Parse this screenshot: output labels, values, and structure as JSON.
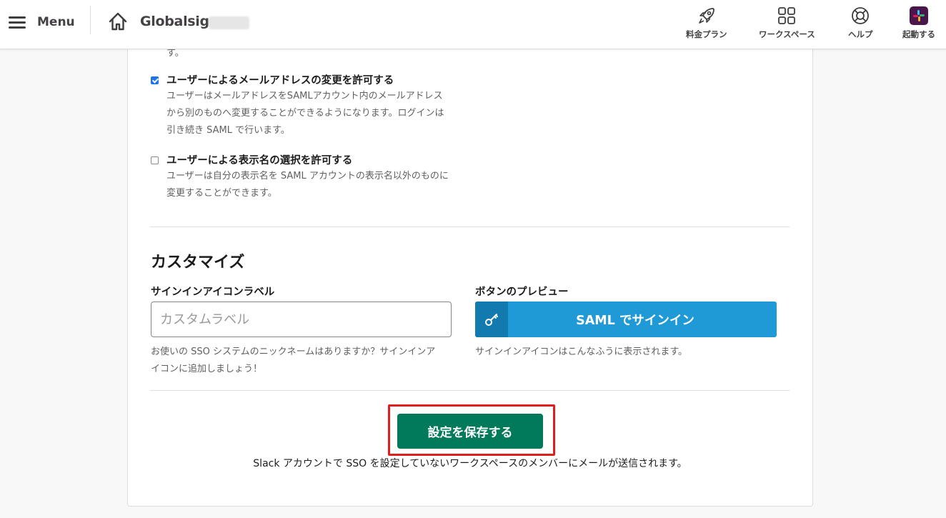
{
  "header": {
    "menu_label": "Menu",
    "workspace_name": "Globalsign",
    "nav": [
      {
        "label": "料金プラン",
        "icon": "rocket-icon"
      },
      {
        "label": "ワークスペース",
        "icon": "grid-icon"
      },
      {
        "label": "ヘルプ",
        "icon": "lifebuoy-icon"
      },
      {
        "label": "起動する",
        "icon": "slack-logo-icon"
      }
    ]
  },
  "options": {
    "cut_text": "す。",
    "email_change": {
      "checked": true,
      "title": "ユーザーによるメールアドレスの変更を許可する",
      "desc": "ユーザーはメールアドレスをSAMLアカウント内のメールアドレスから別のものへ変更することができるようになります。ログインは引き続き SAML で行います。"
    },
    "display_name": {
      "checked": false,
      "title": "ユーザーによる表示名の選択を許可する",
      "desc": "ユーザーは自分の表示名を SAML アカウントの表示名以外のものに変更することができます。"
    }
  },
  "customize": {
    "title": "カスタマイズ",
    "signin_label": {
      "label": "サインインアイコンラベル",
      "placeholder": "カスタムラベル",
      "value": "",
      "help": "お使いの SSO システムのニックネームはありますか？サインインアイコンに追加しましょう！"
    },
    "preview": {
      "label": "ボタンのプレビュー",
      "button_text": "SAML でサインイン",
      "help": "サインインアイコンはこんなふうに表示されます。"
    }
  },
  "actions": {
    "save_label": "設定を保存する",
    "note": "Slack アカウントで SSO を設定していないワークスペースのメンバーにメールが送信されます。"
  },
  "colors": {
    "save_button": "#007a5a",
    "saml_button": "#1f9ad6",
    "highlight": "#e01e1e",
    "checkbox": "#1e73e8"
  }
}
